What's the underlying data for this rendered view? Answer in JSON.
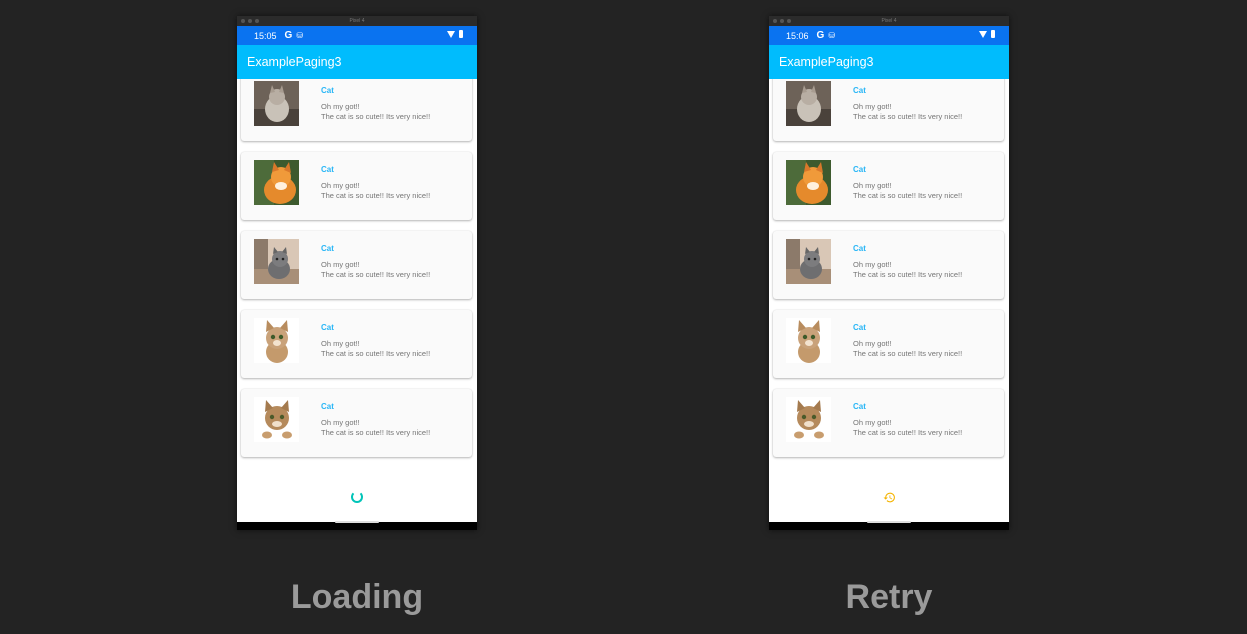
{
  "captions": {
    "left": "Loading",
    "right": "Retry"
  },
  "devices": [
    {
      "window_title": "Pixel 4",
      "status": {
        "time": "15:05",
        "g": "G",
        "sd": "⛁"
      },
      "app_title": "ExamplePaging3",
      "footer_state": "loading"
    },
    {
      "window_title": "Pixel 4",
      "status": {
        "time": "15:06",
        "g": "G",
        "sd": "⛁"
      },
      "app_title": "ExamplePaging3",
      "footer_state": "retry"
    }
  ],
  "items": [
    {
      "title": "Cat",
      "line1": "Oh my got!!",
      "line2": "The cat is so cute!! Its very nice!!",
      "image": "cat-photo-gray"
    },
    {
      "title": "Cat",
      "line1": "Oh my got!!",
      "line2": "The cat is so cute!! Its very nice!!",
      "image": "cat-photo-orange"
    },
    {
      "title": "Cat",
      "line1": "Oh my got!!",
      "line2": "The cat is so cute!! Its very nice!!",
      "image": "cat-photo-kitten"
    },
    {
      "title": "Cat",
      "line1": "Oh my got!!",
      "line2": "The cat is so cute!! Its very nice!!",
      "image": "cat-photo-tabby"
    },
    {
      "title": "Cat",
      "line1": "Oh my got!!",
      "line2": "The cat is so cute!! Its very nice!!",
      "image": "cat-photo-tabby-paws"
    }
  ],
  "colors": {
    "status_bar": "#0a73f0",
    "app_bar": "#00bcfd",
    "title_text": "#29b6f6",
    "spinner": "#00c4b8",
    "retry": "#f5b400"
  },
  "icons": {
    "loading": "progress-spinner-icon",
    "retry": "history-retry-icon"
  }
}
